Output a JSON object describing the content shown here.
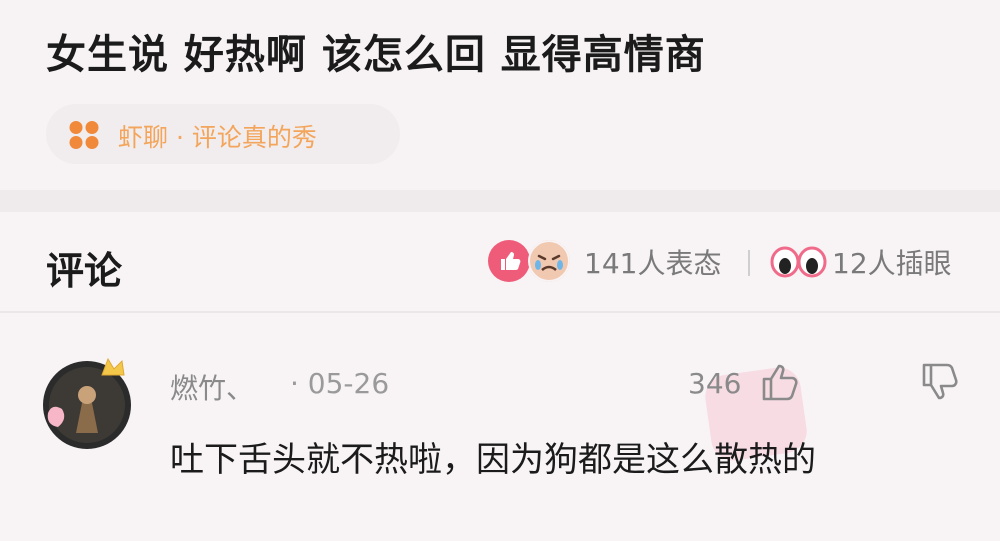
{
  "post": {
    "title": "女生说 好热啊 该怎么回 显得高情商",
    "topic": "虾聊 · 评论真的秀",
    "topic_color": "#f3a55b"
  },
  "comments_header": {
    "title": "评论",
    "reactions_text": "141人表态",
    "eyes_text": "12人插眼"
  },
  "comment": {
    "username": "燃竹、",
    "date": "· 05-26",
    "likes": "346",
    "body": "吐下舌头就不热啦，因为狗都是这么散热的"
  }
}
